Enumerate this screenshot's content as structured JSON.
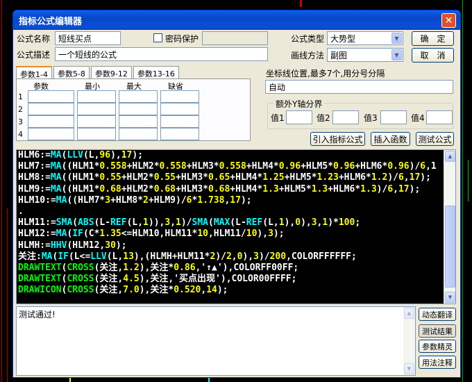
{
  "window": {
    "title": "指标公式编辑器",
    "close_glyph": "✕"
  },
  "formula": {
    "name_label": "公式名称",
    "name_value": "短线买点",
    "password_label": "密码保护",
    "desc_label": "公式描述",
    "desc_value": "一个短线的公式",
    "type_label": "公式类型",
    "type_value": "大势型",
    "draw_label": "画线方法",
    "draw_value": "副图",
    "ok_label": "确　定",
    "cancel_label": "取　消"
  },
  "tabs": [
    "参数1-4",
    "参数5-8",
    "参数9-12",
    "参数13-16"
  ],
  "params": {
    "headers": [
      "参数",
      "最小",
      "最大",
      "缺省"
    ],
    "rows": [
      "1",
      "2",
      "3",
      "4"
    ]
  },
  "coords": {
    "label": "坐标线位置,最多7个,用分号分隔",
    "value": "自动",
    "group_title": "额外Y轴分界",
    "v1": "值1",
    "v2": "值2",
    "v3": "值3",
    "v4": "值4"
  },
  "actions": {
    "import": "引入指标公式",
    "insert": "插入函数",
    "test": "测试公式"
  },
  "code_lines": [
    [
      [
        "w",
        "HLM6:="
      ],
      [
        "c",
        "MA"
      ],
      [
        "w",
        "("
      ],
      [
        "c",
        "LLV"
      ],
      [
        "w",
        "(L,"
      ],
      [
        "y",
        "96"
      ],
      [
        "w",
        "),"
      ],
      [
        "y",
        "17"
      ],
      [
        "w",
        ");"
      ]
    ],
    [
      [
        "w",
        "HLM7:="
      ],
      [
        "c",
        "MA"
      ],
      [
        "w",
        "((HLM1*"
      ],
      [
        "y",
        "0.558"
      ],
      [
        "w",
        "+HLM2*"
      ],
      [
        "y",
        "0.558"
      ],
      [
        "w",
        "+HLM3*"
      ],
      [
        "y",
        "0.558"
      ],
      [
        "w",
        "+HLM4*"
      ],
      [
        "y",
        "0.96"
      ],
      [
        "w",
        "+HLM5*"
      ],
      [
        "y",
        "0.96"
      ],
      [
        "w",
        "+HLM6*"
      ],
      [
        "y",
        "0.96"
      ],
      [
        "w",
        ")/"
      ],
      [
        "y",
        "6"
      ],
      [
        "w",
        ",1"
      ]
    ],
    [
      [
        "w",
        "HLM8:="
      ],
      [
        "c",
        "MA"
      ],
      [
        "w",
        "((HLM1*"
      ],
      [
        "y",
        "0.55"
      ],
      [
        "w",
        "+HLM2*"
      ],
      [
        "y",
        "0.55"
      ],
      [
        "w",
        "+HLM3*"
      ],
      [
        "y",
        "0.65"
      ],
      [
        "w",
        "+HLM4*"
      ],
      [
        "y",
        "1.25"
      ],
      [
        "w",
        "+HLM5*"
      ],
      [
        "y",
        "1.23"
      ],
      [
        "w",
        "+HLM6*"
      ],
      [
        "y",
        "1.2"
      ],
      [
        "w",
        ")/"
      ],
      [
        "y",
        "6"
      ],
      [
        "w",
        ","
      ],
      [
        "y",
        "17"
      ],
      [
        "w",
        ");"
      ]
    ],
    [
      [
        "w",
        "HLM9:="
      ],
      [
        "c",
        "MA"
      ],
      [
        "w",
        "((HLM1*"
      ],
      [
        "y",
        "0.68"
      ],
      [
        "w",
        "+HLM2*"
      ],
      [
        "y",
        "0.68"
      ],
      [
        "w",
        "+HLM3*"
      ],
      [
        "y",
        "0.68"
      ],
      [
        "w",
        "+HLM4*"
      ],
      [
        "y",
        "1.3"
      ],
      [
        "w",
        "+HLM5*"
      ],
      [
        "y",
        "1.3"
      ],
      [
        "w",
        "+HLM6*"
      ],
      [
        "y",
        "1.3"
      ],
      [
        "w",
        ")/"
      ],
      [
        "y",
        "6"
      ],
      [
        "w",
        ","
      ],
      [
        "y",
        "17"
      ],
      [
        "w",
        ");"
      ]
    ],
    [
      [
        "w",
        "HLM10:="
      ],
      [
        "c",
        "MA"
      ],
      [
        "w",
        "((HLM7*"
      ],
      [
        "y",
        "3"
      ],
      [
        "w",
        "+HLM8*"
      ],
      [
        "y",
        "2"
      ],
      [
        "w",
        "+HLM9)/"
      ],
      [
        "y",
        "6"
      ],
      [
        "w",
        "*"
      ],
      [
        "y",
        "1.738"
      ],
      [
        "w",
        ","
      ],
      [
        "y",
        "17"
      ],
      [
        "w",
        ");"
      ]
    ],
    [
      [
        "w",
        "."
      ]
    ],
    [
      [
        "w",
        "HLM11:="
      ],
      [
        "c",
        "SMA"
      ],
      [
        "w",
        "("
      ],
      [
        "c",
        "ABS"
      ],
      [
        "w",
        "(L-"
      ],
      [
        "c",
        "REF"
      ],
      [
        "w",
        "(L,"
      ],
      [
        "y",
        "1"
      ],
      [
        "w",
        ")),"
      ],
      [
        "y",
        "3"
      ],
      [
        "w",
        ","
      ],
      [
        "y",
        "1"
      ],
      [
        "w",
        ")/"
      ],
      [
        "c",
        "SMA"
      ],
      [
        "w",
        "("
      ],
      [
        "c",
        "MAX"
      ],
      [
        "w",
        "(L-"
      ],
      [
        "c",
        "REF"
      ],
      [
        "w",
        "(L,"
      ],
      [
        "y",
        "1"
      ],
      [
        "w",
        "),"
      ],
      [
        "y",
        "0"
      ],
      [
        "w",
        "),"
      ],
      [
        "y",
        "3"
      ],
      [
        "w",
        ","
      ],
      [
        "y",
        "1"
      ],
      [
        "w",
        ")*"
      ],
      [
        "y",
        "100"
      ],
      [
        "w",
        ";"
      ]
    ],
    [
      [
        "w",
        "HLM12:="
      ],
      [
        "c",
        "MA"
      ],
      [
        "w",
        "("
      ],
      [
        "c",
        "IF"
      ],
      [
        "w",
        "(C*"
      ],
      [
        "y",
        "1.35"
      ],
      [
        "w",
        "<=HLM10,HLM11*"
      ],
      [
        "y",
        "10"
      ],
      [
        "w",
        ",HLM11/"
      ],
      [
        "y",
        "10"
      ],
      [
        "w",
        "),"
      ],
      [
        "y",
        "3"
      ],
      [
        "w",
        ");"
      ]
    ],
    [
      [
        "w",
        "HLMH:="
      ],
      [
        "c",
        "HHV"
      ],
      [
        "w",
        "(HLM12,"
      ],
      [
        "y",
        "30"
      ],
      [
        "w",
        ");"
      ]
    ],
    [
      [
        "w",
        "关注:"
      ],
      [
        "c",
        "MA"
      ],
      [
        "w",
        "("
      ],
      [
        "c",
        "IF"
      ],
      [
        "w",
        "(L<="
      ],
      [
        "c",
        "LLV"
      ],
      [
        "w",
        "(L,"
      ],
      [
        "y",
        "13"
      ],
      [
        "w",
        "),(HLMH+HLM11*"
      ],
      [
        "y",
        "2"
      ],
      [
        "w",
        ")/"
      ],
      [
        "y",
        "2"
      ],
      [
        "w",
        ","
      ],
      [
        "y",
        "0"
      ],
      [
        "w",
        "),"
      ],
      [
        "y",
        "3"
      ],
      [
        "w",
        ")/"
      ],
      [
        "y",
        "200"
      ],
      [
        "w",
        ",COLORFFFFFF;"
      ]
    ],
    [
      [
        "g",
        "DRAWTEXT"
      ],
      [
        "w",
        "("
      ],
      [
        "g",
        "CROSS"
      ],
      [
        "w",
        "(关注,"
      ],
      [
        "y",
        "1.2"
      ],
      [
        "w",
        "),关注*"
      ],
      [
        "y",
        "0.86"
      ],
      [
        "w",
        ",'↑▲'),COLORFF00FF;"
      ]
    ],
    [
      [
        "g",
        "DRAWTEXT"
      ],
      [
        "w",
        "("
      ],
      [
        "g",
        "CROSS"
      ],
      [
        "w",
        "(关注,"
      ],
      [
        "y",
        "4.5"
      ],
      [
        "w",
        "),关注,'买点出现'),COLOR00FFFF;"
      ]
    ],
    [
      [
        "g",
        "DRAWICON"
      ],
      [
        "w",
        "("
      ],
      [
        "g",
        "CROSS"
      ],
      [
        "w",
        "(关注,"
      ],
      [
        "y",
        "7.0"
      ],
      [
        "w",
        "),关注*"
      ],
      [
        "y",
        "0.520"
      ],
      [
        "w",
        ","
      ],
      [
        "y",
        "14"
      ],
      [
        "w",
        ");"
      ]
    ]
  ],
  "result": {
    "text": "测试通过!"
  },
  "side_buttons": [
    "动态翻译",
    "测试结果",
    "参数精灵",
    "用法注释"
  ]
}
